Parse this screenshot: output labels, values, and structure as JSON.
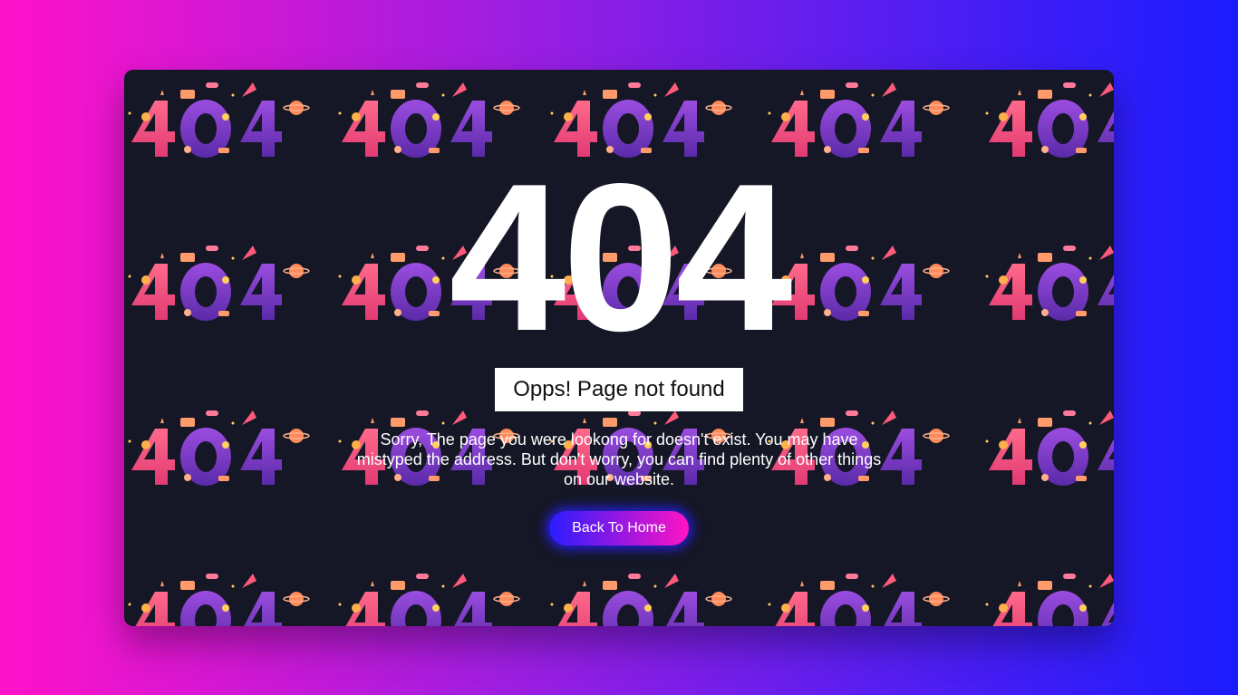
{
  "error": {
    "code": "404",
    "title": "Opps! Page not found",
    "message": "Sorry, The page you were lookong for doesn't exist. You may have mistyped the address. But don't worry, you can find plenty of other things on our website.",
    "button_label": "Back To Home"
  },
  "background": {
    "pattern_icon": "404-illustration-icon"
  },
  "colors": {
    "gradient_start": "#ff12c9",
    "gradient_end": "#1a1cff",
    "card": "#151726",
    "text": "#ffffff"
  }
}
